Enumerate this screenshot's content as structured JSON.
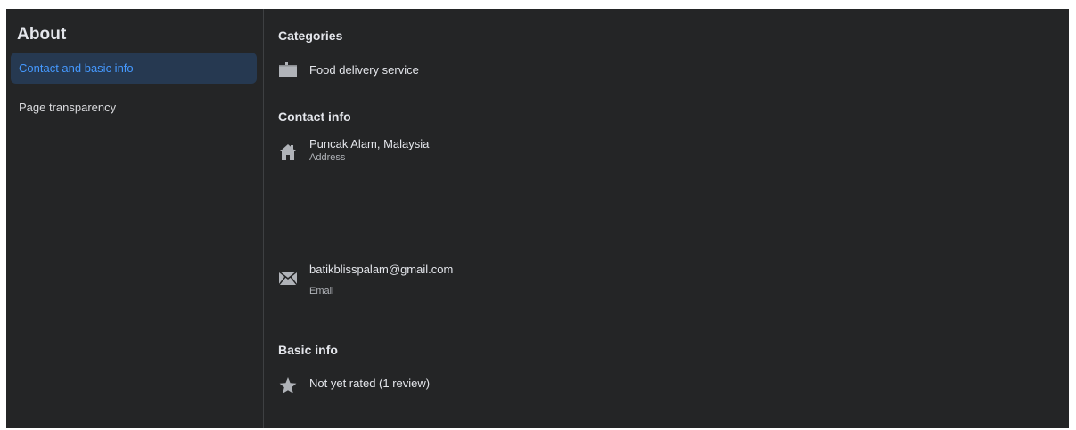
{
  "sidebar": {
    "title": "About",
    "items": [
      {
        "label": "Contact and basic info",
        "active": true
      },
      {
        "label": "Page transparency",
        "active": false
      }
    ]
  },
  "categories": {
    "title": "Categories",
    "item": {
      "label": "Food delivery service",
      "icon": "category-icon"
    }
  },
  "contact": {
    "title": "Contact info",
    "address": {
      "value": "Puncak Alam, Malaysia",
      "label": "Address",
      "icon": "home-icon"
    },
    "email": {
      "value": "batikblisspalam@gmail.com",
      "label": "Email",
      "icon": "envelope-icon"
    }
  },
  "basic": {
    "title": "Basic info",
    "rating": {
      "value": "Not yet rated (1 review)",
      "icon": "star-icon"
    }
  },
  "colors": {
    "background": "#242526",
    "active_item_bg": "#263951",
    "accent": "#4599ff",
    "icon": "#b0b3b8"
  }
}
